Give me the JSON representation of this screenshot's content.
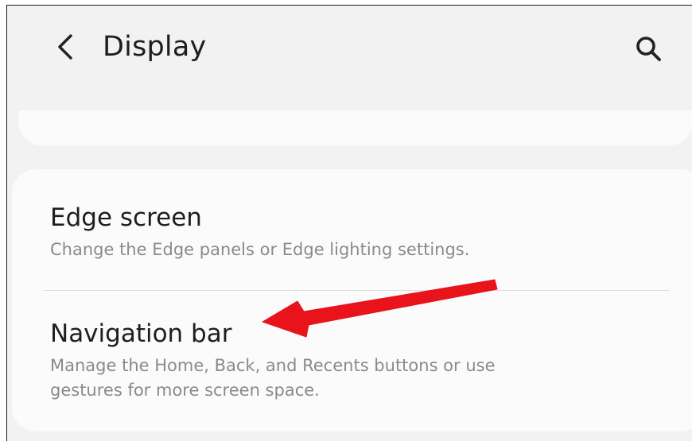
{
  "header": {
    "title": "Display",
    "back_icon": "chevron-left-icon",
    "search_icon": "search-icon"
  },
  "settings": [
    {
      "title": "Edge screen",
      "description": "Change the Edge panels or Edge lighting settings."
    },
    {
      "title": "Navigation bar",
      "description_line1": "Manage the Home, Back, and Recents buttons or use",
      "description_line2": "gestures for more screen space."
    }
  ],
  "annotation": {
    "icon": "arrow-annotation-icon",
    "color": "#e8131b"
  },
  "colors": {
    "background": "#f2f2f2",
    "card": "#fbfbfb",
    "title_text": "#1e1e1e",
    "secondary_text": "#8a8a8a"
  }
}
